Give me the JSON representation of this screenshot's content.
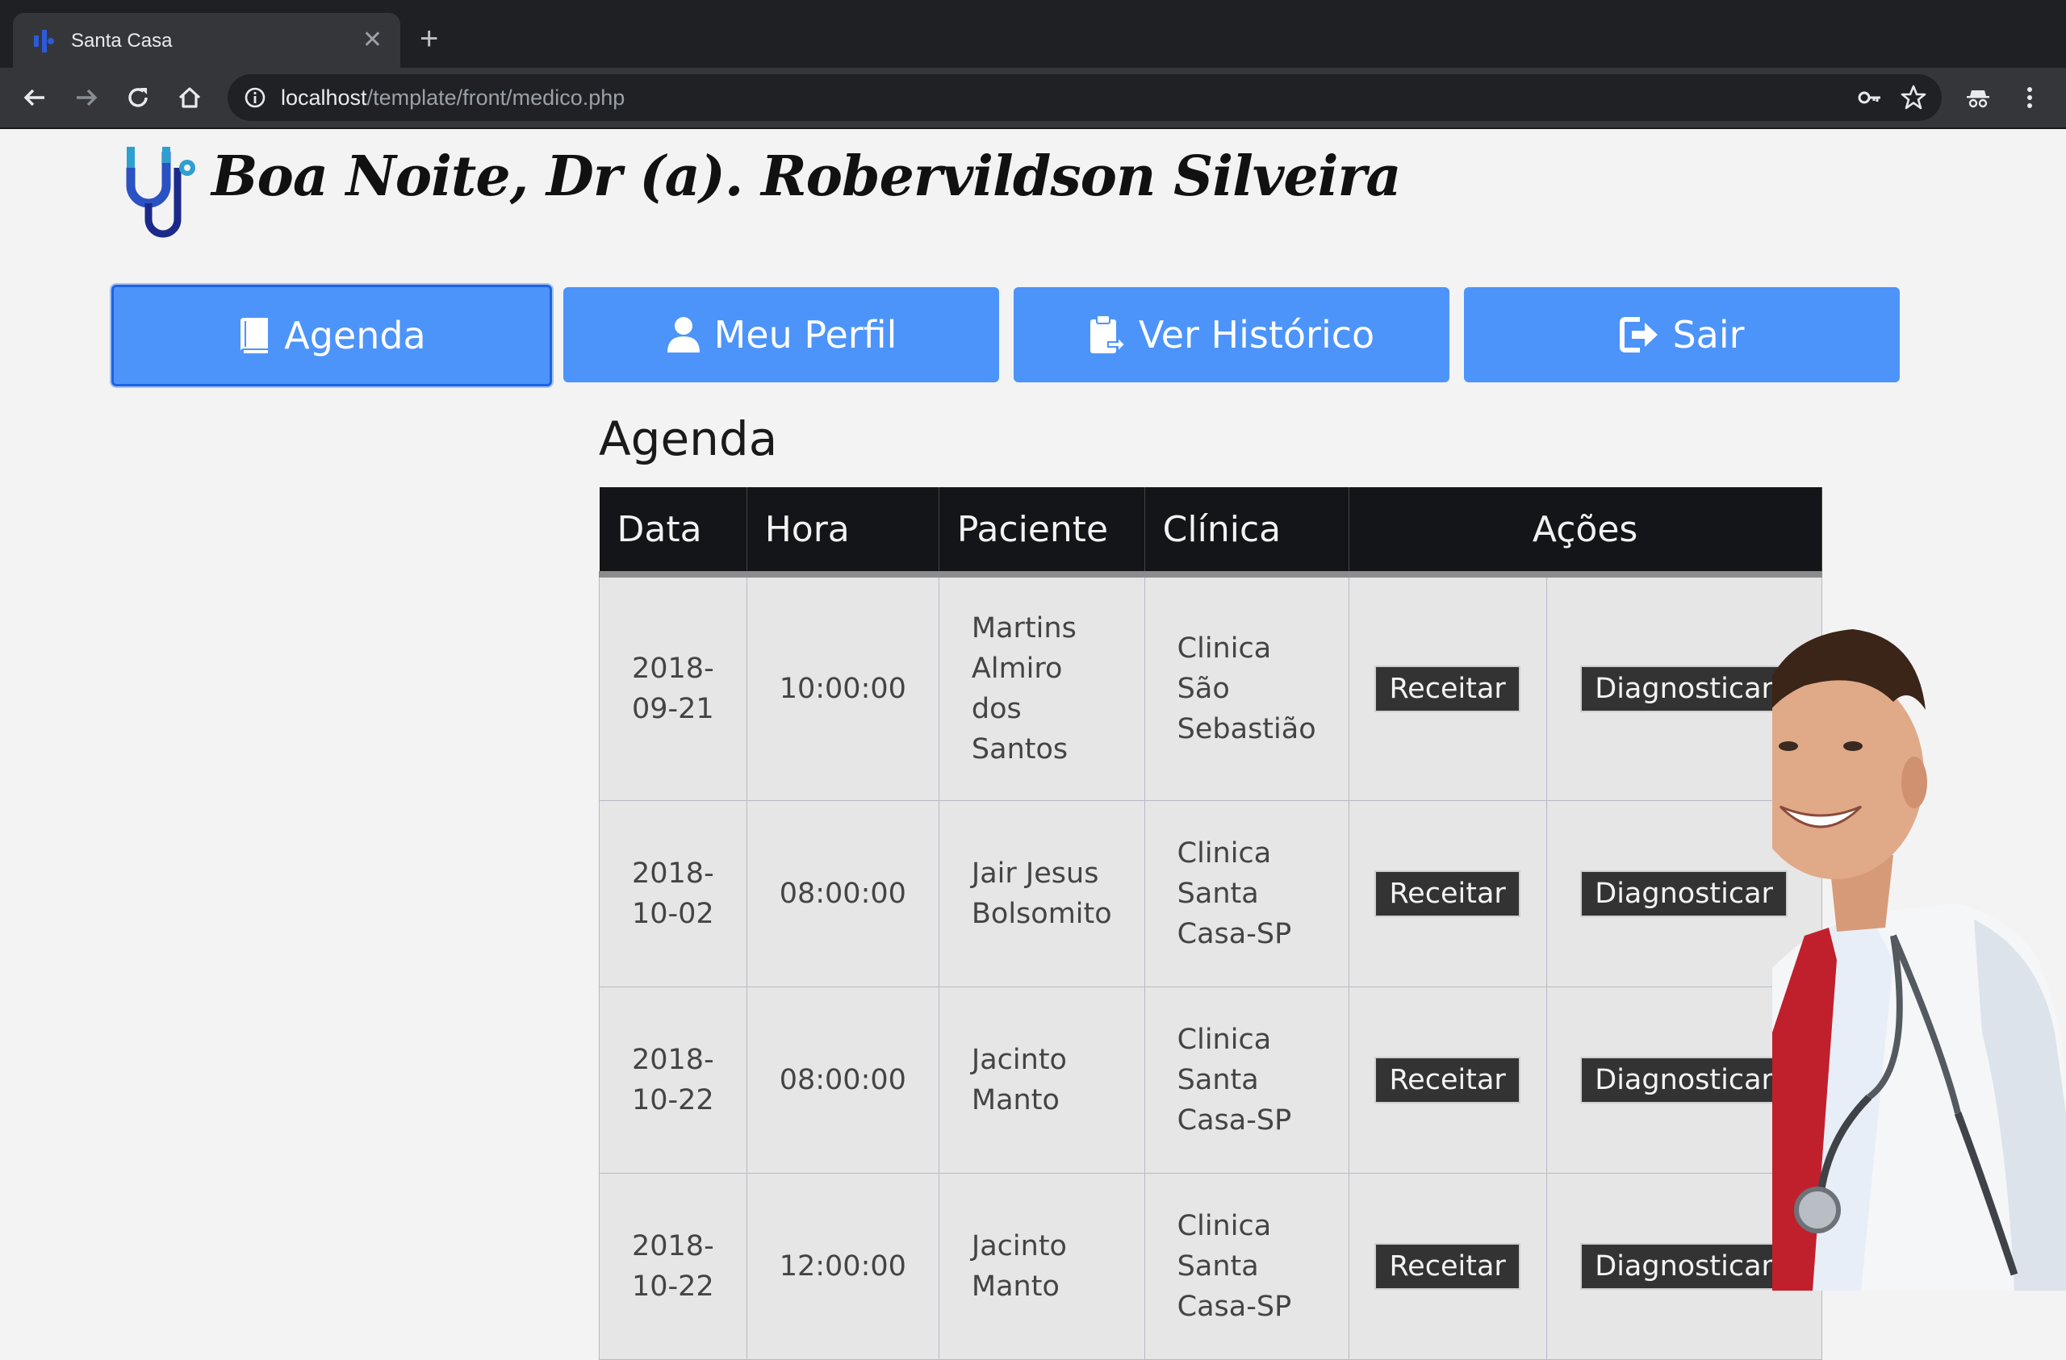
{
  "browser": {
    "tab_title": "Santa Casa",
    "tab_close": "✕",
    "new_tab": "+",
    "url_host": "localhost",
    "url_path": "/template/front/medico.php"
  },
  "header": {
    "greeting": "Boa Noite, Dr (a). Robervildson Silveira"
  },
  "nav": [
    {
      "label": "Agenda",
      "icon": "book-icon",
      "active": true
    },
    {
      "label": "Meu Perfil",
      "icon": "user-icon"
    },
    {
      "label": "Ver Histórico",
      "icon": "clipboard-icon"
    },
    {
      "label": "Sair",
      "icon": "logout-icon"
    }
  ],
  "agenda": {
    "title": "Agenda",
    "columns": [
      "Data",
      "Hora",
      "Paciente",
      "Clínica",
      "Ações"
    ],
    "action_receitar": "Receitar",
    "action_diagnosticar": "Diagnosticar",
    "rows": [
      {
        "data": "2018-09-21",
        "hora": "10:00:00",
        "paciente": "Martins Almiro dos Santos",
        "clinica": "Clinica São Sebastião"
      },
      {
        "data": "2018-10-02",
        "hora": "08:00:00",
        "paciente": "Jair Jesus Bolsomito",
        "clinica": "Clinica Santa Casa-SP"
      },
      {
        "data": "2018-10-22",
        "hora": "08:00:00",
        "paciente": "Jacinto Manto",
        "clinica": "Clinica Santa Casa-SP"
      },
      {
        "data": "2018-10-22",
        "hora": "12:00:00",
        "paciente": "Jacinto Manto",
        "clinica": "Clinica Santa Casa-SP"
      }
    ]
  },
  "colors": {
    "nav_button": "#4d94fa",
    "table_header": "#141518",
    "action_button": "#333334"
  }
}
